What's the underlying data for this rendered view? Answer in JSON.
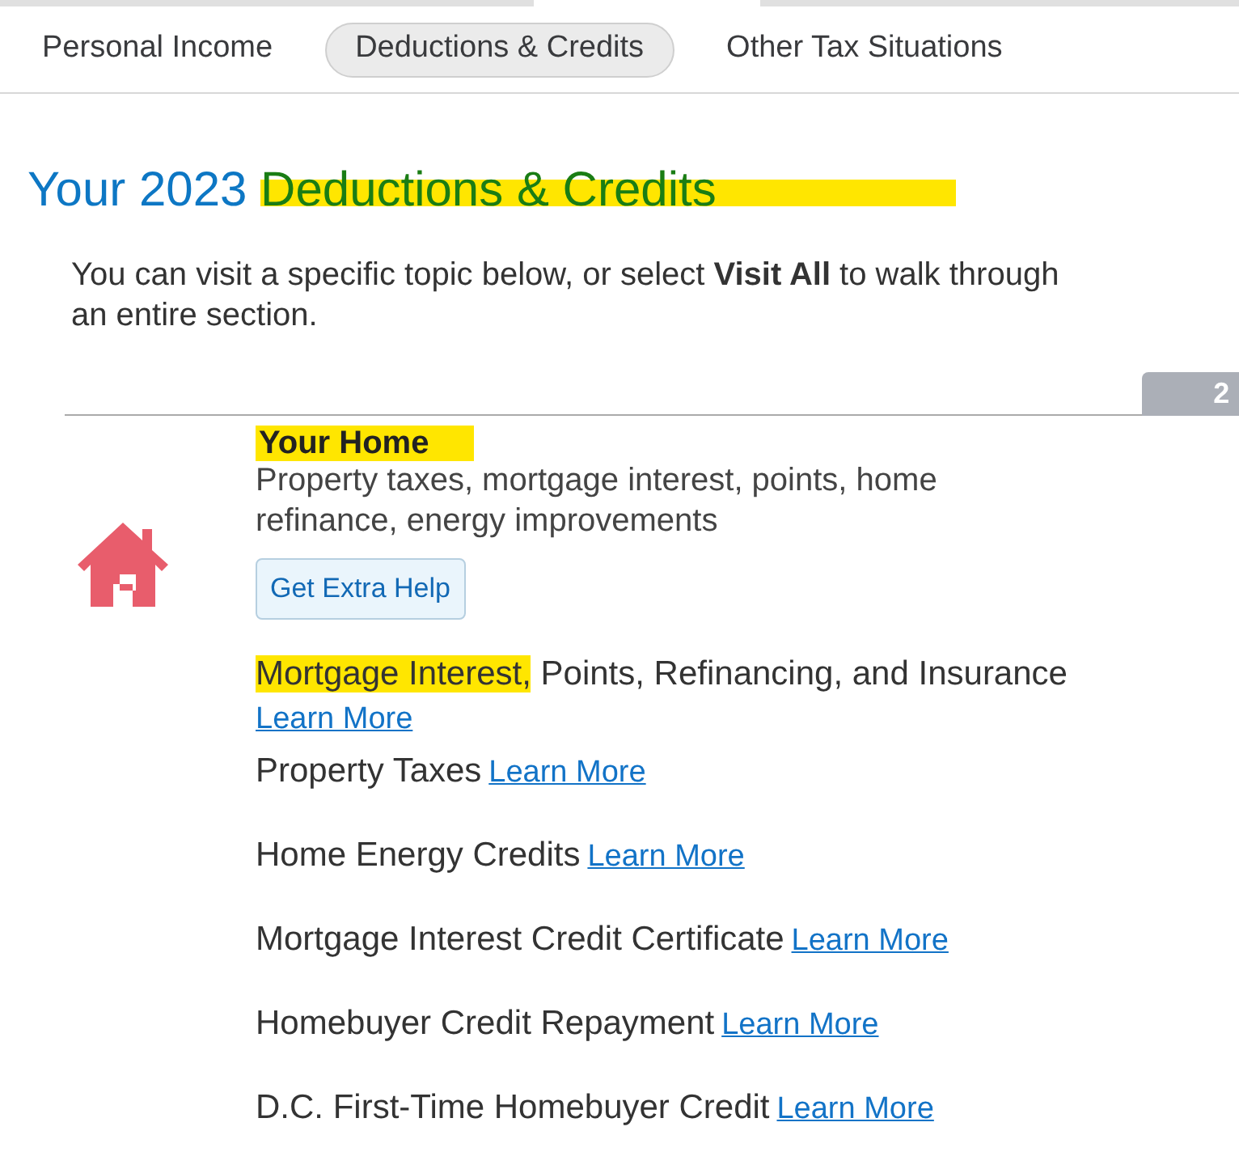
{
  "tabs": [
    {
      "label": "Personal Income",
      "selected": false
    },
    {
      "label": "Deductions & Credits",
      "selected": true
    },
    {
      "label": "Other Tax Situations",
      "selected": false
    }
  ],
  "title": [
    {
      "text": "Your 2023 ",
      "highlighted": false
    },
    {
      "text": "Deductions & Credits",
      "highlighted": true
    }
  ],
  "intro": "You can visit a specific topic below, or select **Visit All** to walk through an entire section.",
  "side_tab": "2",
  "section": {
    "heading": "Your Home",
    "heading_highlighted": true,
    "description": "Property taxes, mortgage interest, points, home refinance, energy improvements",
    "help_button": "Get Extra Help",
    "topics": [
      {
        "highlight": "Mortgage Interest,",
        "label": "Points, Refinancing, and Insurance",
        "link": "Learn More"
      },
      {
        "label": "Property Taxes",
        "link": "Learn More"
      },
      {
        "label": "Home Energy Credits",
        "link": "Learn More"
      },
      {
        "label": "Mortgage Interest Credit Certificate",
        "link": "Learn More"
      },
      {
        "label": "Homebuyer Credit Repayment",
        "link": "Learn More"
      },
      {
        "label": "D.C. First-Time Homebuyer Credit",
        "link": "Learn More"
      }
    ]
  }
}
